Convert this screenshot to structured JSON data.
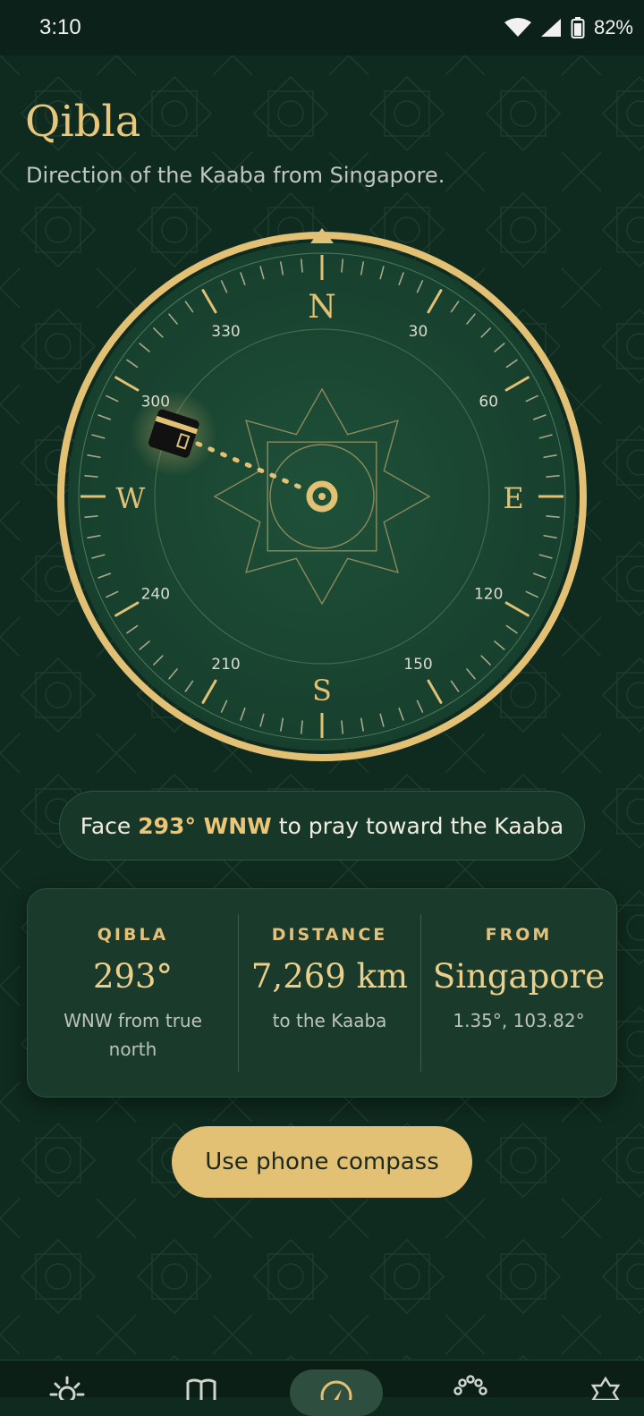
{
  "status_bar": {
    "time": "3:10",
    "battery": "82%"
  },
  "header": {
    "title": "Qibla",
    "subtitle": "Direction of the Kaaba from Singapore."
  },
  "compass": {
    "cardinals": {
      "n": "N",
      "e": "E",
      "s": "S",
      "w": "W"
    },
    "degree_labels": [
      {
        "label": "30",
        "angle": 30
      },
      {
        "label": "60",
        "angle": 60
      },
      {
        "label": "120",
        "angle": 120
      },
      {
        "label": "150",
        "angle": 150
      },
      {
        "label": "210",
        "angle": 210
      },
      {
        "label": "240",
        "angle": 240
      },
      {
        "label": "300",
        "angle": 300
      },
      {
        "label": "330",
        "angle": 330
      }
    ],
    "qibla_bearing": 293
  },
  "face_banner": {
    "prefix": "Face",
    "bearing": "293° WNW",
    "suffix": "to pray toward the Kaaba"
  },
  "info": {
    "qibla": {
      "label": "QIBLA",
      "value": "293°",
      "sub": "WNW from true north"
    },
    "distance": {
      "label": "DISTANCE",
      "value": "7,269 km",
      "sub": "to the Kaaba"
    },
    "from": {
      "label": "FROM",
      "value": "Singapore",
      "sub": "1.35°, 103.82°"
    }
  },
  "action": {
    "compass_button": "Use phone compass"
  },
  "nav": {
    "items": [
      {
        "icon": "sun-icon"
      },
      {
        "icon": "book-icon"
      },
      {
        "icon": "compass-icon",
        "active": true
      },
      {
        "icon": "prayer-beads-icon"
      },
      {
        "icon": "star-settings-icon"
      }
    ]
  },
  "colors": {
    "accent": "#e2c074",
    "background": "#0f2a1f",
    "dial": "#1b4634"
  }
}
